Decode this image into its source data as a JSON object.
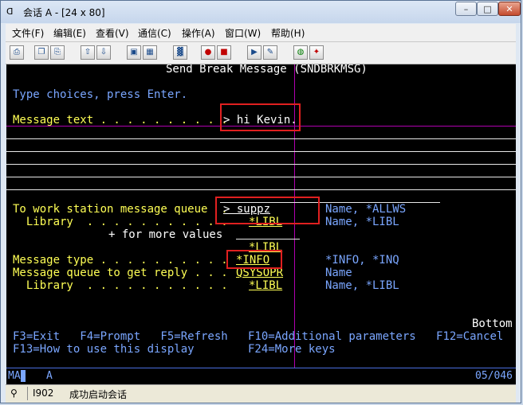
{
  "window": {
    "title": "会话 A - [24 x 80]",
    "icon_label": "ᗡ"
  },
  "menu": [
    "文件(F)",
    "编辑(E)",
    "查看(V)",
    "通信(C)",
    "操作(A)",
    "窗口(W)",
    "帮助(H)"
  ],
  "screen": {
    "header": "Send Break Message (SNDBRKMSG)",
    "instruction": "Type choices, press Enter.",
    "message_text_label": "Message text . . . . . . . . . .",
    "message_text_value": "> hi Kevin.",
    "to_queue_label": "To work station message queue  .",
    "to_queue_value": "> suppz",
    "to_queue_hint": "Name, *ALLWS",
    "library1_label": "  Library  . . . . . . . . . . .",
    "library1_value": "*LIBL",
    "library1_hint": "Name, *LIBL",
    "more_values": "+ for more values",
    "library2_value": "*LIBL",
    "message_type_label": "Message type . . . . . . . . . .",
    "message_type_value": "*INFO",
    "message_type_hint": "*INFO, *INQ",
    "reply_queue_label": "Message queue to get reply . . .",
    "reply_queue_value": "QSYSOPR",
    "reply_queue_hint": "Name",
    "library3_label": "  Library  . . . . . . . . . . .",
    "library3_value": "*LIBL",
    "library3_hint": "Name, *LIBL",
    "bottom_indicator": "Bottom",
    "fkeys_row1": "F3=Exit   F4=Prompt   F5=Refresh   F10=Additional parameters   F12=Cancel",
    "fkeys_row2": "F13=How to use this display        F24=More keys"
  },
  "oia": {
    "mode": "MA",
    "session": "A",
    "cursor_pos": "05/046"
  },
  "statusbar": {
    "icon_label": "⚲",
    "message_id": "I902",
    "message": "成功启动会话"
  },
  "colors": {
    "screen_bg": "#000000",
    "field_blue": "#7aa6ff",
    "field_green": "#45ff45",
    "field_yellow": "#ffff55",
    "highlight_box": "#e02020"
  }
}
